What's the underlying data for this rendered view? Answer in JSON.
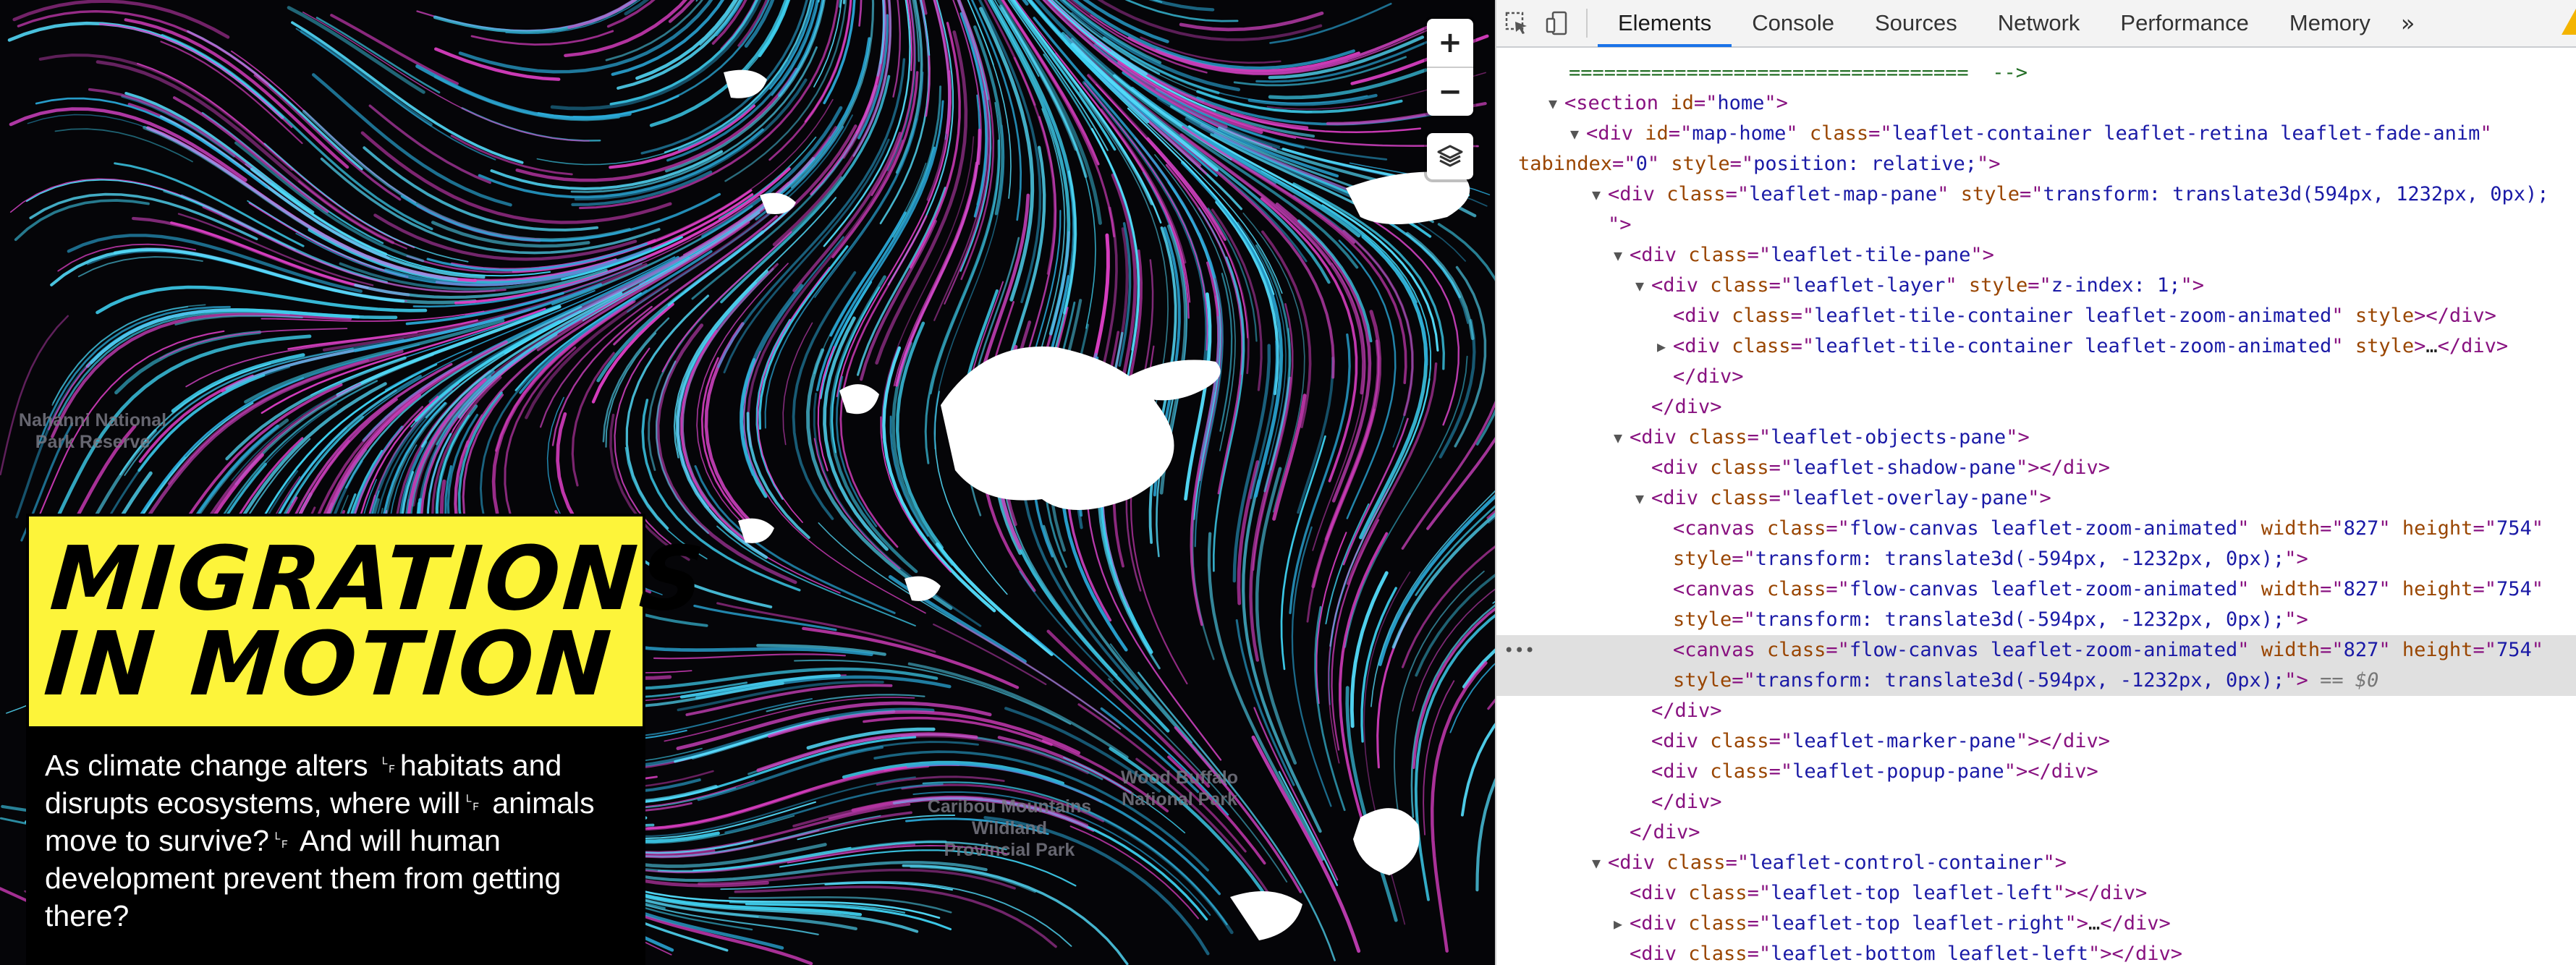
{
  "map": {
    "labels": [
      {
        "id": "nahanni",
        "text": "Nahanni National\nPark Reserve"
      },
      {
        "id": "caribou",
        "text": "Caribou Mountains\nWildland\nProvincial Park"
      },
      {
        "id": "wood-buffalo",
        "text": "Wood Buffalo\nNational Park"
      }
    ],
    "controls": {
      "zoom_in": "+",
      "zoom_out": "−",
      "layers_icon": "layers-icon"
    },
    "colors": {
      "cyan": "#3fd2f2",
      "magenta": "#e040c8",
      "land": "#ffffff",
      "background": "#050508"
    }
  },
  "story": {
    "title": "MIGRATIONS\nIN MOTION",
    "intro": "As climate change alters ␊habitats and disrupts ecosystems, where will␊ animals move to survive?␊ And will human development prevent them from getting there?",
    "title_bg": "#fdf43a"
  },
  "devtools": {
    "tabs": [
      {
        "label": "Elements",
        "active": true
      },
      {
        "label": "Console",
        "active": false
      },
      {
        "label": "Sources",
        "active": false
      },
      {
        "label": "Network",
        "active": false
      },
      {
        "label": "Performance",
        "active": false
      },
      {
        "label": "Memory",
        "active": false
      }
    ],
    "more": "»",
    "accent": "#1a73e8"
  },
  "dom_lines": [
    {
      "indent": 0,
      "tw": "",
      "parts": [
        [
          "cm",
          "==================================  -->"
        ]
      ]
    },
    {
      "indent": 1,
      "tw": "open",
      "parts": [
        [
          "tag",
          "<section "
        ],
        [
          "an",
          "id"
        ],
        [
          "tag",
          "=\""
        ],
        [
          "av",
          "home"
        ],
        [
          "tag",
          "\">"
        ]
      ]
    },
    {
      "indent": 2,
      "tw": "open",
      "parts": [
        [
          "tag",
          "<div "
        ],
        [
          "an",
          "id"
        ],
        [
          "tag",
          "=\""
        ],
        [
          "av",
          "map-home"
        ],
        [
          "tag",
          "\" "
        ],
        [
          "an",
          "class"
        ],
        [
          "tag",
          "=\""
        ],
        [
          "av",
          "leaflet-container leaflet-retina leaflet-fade-anim"
        ],
        [
          "tag",
          "\""
        ]
      ]
    },
    {
      "indent": 0,
      "tw": "",
      "parts": [
        [
          "an",
          "tabindex"
        ],
        [
          "tag",
          "=\""
        ],
        [
          "av",
          "0"
        ],
        [
          "tag",
          "\" "
        ],
        [
          "an",
          "style"
        ],
        [
          "tag",
          "=\""
        ],
        [
          "av",
          "position: relative;"
        ],
        [
          "tag",
          "\">"
        ]
      ]
    },
    {
      "indent": 3,
      "tw": "open",
      "parts": [
        [
          "tag",
          "<div "
        ],
        [
          "an",
          "class"
        ],
        [
          "tag",
          "=\""
        ],
        [
          "av",
          "leaflet-map-pane"
        ],
        [
          "tag",
          "\" "
        ],
        [
          "an",
          "style"
        ],
        [
          "tag",
          "=\""
        ],
        [
          "av",
          "transform: translate3d(594px, 1232px, 0px);"
        ]
      ]
    },
    {
      "indent": 3,
      "tw": "",
      "parts": [
        [
          "tag",
          "\">"
        ]
      ]
    },
    {
      "indent": 4,
      "tw": "open",
      "parts": [
        [
          "tag",
          "<div "
        ],
        [
          "an",
          "class"
        ],
        [
          "tag",
          "=\""
        ],
        [
          "av",
          "leaflet-tile-pane"
        ],
        [
          "tag",
          "\">"
        ]
      ]
    },
    {
      "indent": 5,
      "tw": "open",
      "parts": [
        [
          "tag",
          "<div "
        ],
        [
          "an",
          "class"
        ],
        [
          "tag",
          "=\""
        ],
        [
          "av",
          "leaflet-layer"
        ],
        [
          "tag",
          "\" "
        ],
        [
          "an",
          "style"
        ],
        [
          "tag",
          "=\""
        ],
        [
          "av",
          "z-index: 1;"
        ],
        [
          "tag",
          "\">"
        ]
      ]
    },
    {
      "indent": 6,
      "tw": "",
      "parts": [
        [
          "tag",
          "<div "
        ],
        [
          "an",
          "class"
        ],
        [
          "tag",
          "=\""
        ],
        [
          "av",
          "leaflet-tile-container leaflet-zoom-animated"
        ],
        [
          "tag",
          "\" "
        ],
        [
          "an",
          "style"
        ],
        [
          "tag",
          "></div>"
        ]
      ]
    },
    {
      "indent": 6,
      "tw": "closed",
      "parts": [
        [
          "tag",
          "<div "
        ],
        [
          "an",
          "class"
        ],
        [
          "tag",
          "=\""
        ],
        [
          "av",
          "leaflet-tile-container leaflet-zoom-animated"
        ],
        [
          "tag",
          "\" "
        ],
        [
          "an",
          "style"
        ],
        [
          "tag",
          ">"
        ],
        [
          "tx",
          "…"
        ],
        [
          "tag",
          "</div>"
        ]
      ]
    },
    {
      "indent": 6,
      "tw": "",
      "parts": [
        [
          "tag",
          "</div>"
        ]
      ]
    },
    {
      "indent": 5,
      "tw": "",
      "parts": [
        [
          "tag",
          "</div>"
        ]
      ]
    },
    {
      "indent": 4,
      "tw": "open",
      "parts": [
        [
          "tag",
          "<div "
        ],
        [
          "an",
          "class"
        ],
        [
          "tag",
          "=\""
        ],
        [
          "av",
          "leaflet-objects-pane"
        ],
        [
          "tag",
          "\">"
        ]
      ]
    },
    {
      "indent": 5,
      "tw": "",
      "parts": [
        [
          "tag",
          "<div "
        ],
        [
          "an",
          "class"
        ],
        [
          "tag",
          "=\""
        ],
        [
          "av",
          "leaflet-shadow-pane"
        ],
        [
          "tag",
          "\"></div>"
        ]
      ]
    },
    {
      "indent": 5,
      "tw": "open",
      "parts": [
        [
          "tag",
          "<div "
        ],
        [
          "an",
          "class"
        ],
        [
          "tag",
          "=\""
        ],
        [
          "av",
          "leaflet-overlay-pane"
        ],
        [
          "tag",
          "\">"
        ]
      ]
    },
    {
      "indent": 6,
      "tw": "",
      "parts": [
        [
          "tag",
          "<canvas "
        ],
        [
          "an",
          "class"
        ],
        [
          "tag",
          "=\""
        ],
        [
          "av",
          "flow-canvas leaflet-zoom-animated"
        ],
        [
          "tag",
          "\" "
        ],
        [
          "an",
          "width"
        ],
        [
          "tag",
          "=\""
        ],
        [
          "av",
          "827"
        ],
        [
          "tag",
          "\" "
        ],
        [
          "an",
          "height"
        ],
        [
          "tag",
          "=\""
        ],
        [
          "av",
          "754"
        ],
        [
          "tag",
          "\""
        ]
      ]
    },
    {
      "indent": 6,
      "tw": "",
      "parts": [
        [
          "an",
          "style"
        ],
        [
          "tag",
          "=\""
        ],
        [
          "av",
          "transform: translate3d(-594px, -1232px, 0px);"
        ],
        [
          "tag",
          "\">"
        ]
      ]
    },
    {
      "indent": 6,
      "tw": "",
      "parts": [
        [
          "tag",
          "<canvas "
        ],
        [
          "an",
          "class"
        ],
        [
          "tag",
          "=\""
        ],
        [
          "av",
          "flow-canvas leaflet-zoom-animated"
        ],
        [
          "tag",
          "\" "
        ],
        [
          "an",
          "width"
        ],
        [
          "tag",
          "=\""
        ],
        [
          "av",
          "827"
        ],
        [
          "tag",
          "\" "
        ],
        [
          "an",
          "height"
        ],
        [
          "tag",
          "=\""
        ],
        [
          "av",
          "754"
        ],
        [
          "tag",
          "\""
        ]
      ]
    },
    {
      "indent": 6,
      "tw": "",
      "parts": [
        [
          "an",
          "style"
        ],
        [
          "tag",
          "=\""
        ],
        [
          "av",
          "transform: translate3d(-594px, -1232px, 0px);"
        ],
        [
          "tag",
          "\">"
        ]
      ]
    },
    {
      "indent": 6,
      "tw": "",
      "selected": true,
      "parts": [
        [
          "tag",
          "<canvas "
        ],
        [
          "an",
          "class"
        ],
        [
          "tag",
          "=\""
        ],
        [
          "av",
          "flow-canvas leaflet-zoom-animated"
        ],
        [
          "tag",
          "\" "
        ],
        [
          "an",
          "width"
        ],
        [
          "tag",
          "=\""
        ],
        [
          "av",
          "827"
        ],
        [
          "tag",
          "\" "
        ],
        [
          "an",
          "height"
        ],
        [
          "tag",
          "=\""
        ],
        [
          "av",
          "754"
        ],
        [
          "tag",
          "\""
        ]
      ]
    },
    {
      "indent": 6,
      "tw": "",
      "selected": true,
      "parts": [
        [
          "an",
          "style"
        ],
        [
          "tag",
          "=\""
        ],
        [
          "av",
          "transform: translate3d(-594px, -1232px, 0px);"
        ],
        [
          "tag",
          "\">"
        ],
        [
          "eq0",
          " == $0"
        ]
      ]
    },
    {
      "indent": 5,
      "tw": "",
      "parts": [
        [
          "tag",
          "</div>"
        ]
      ]
    },
    {
      "indent": 5,
      "tw": "",
      "parts": [
        [
          "tag",
          "<div "
        ],
        [
          "an",
          "class"
        ],
        [
          "tag",
          "=\""
        ],
        [
          "av",
          "leaflet-marker-pane"
        ],
        [
          "tag",
          "\"></div>"
        ]
      ]
    },
    {
      "indent": 5,
      "tw": "",
      "parts": [
        [
          "tag",
          "<div "
        ],
        [
          "an",
          "class"
        ],
        [
          "tag",
          "=\""
        ],
        [
          "av",
          "leaflet-popup-pane"
        ],
        [
          "tag",
          "\"></div>"
        ]
      ]
    },
    {
      "indent": 5,
      "tw": "",
      "parts": [
        [
          "tag",
          "</div>"
        ]
      ]
    },
    {
      "indent": 4,
      "tw": "",
      "parts": [
        [
          "tag",
          "</div>"
        ]
      ]
    },
    {
      "indent": 3,
      "tw": "open",
      "parts": [
        [
          "tag",
          "<div "
        ],
        [
          "an",
          "class"
        ],
        [
          "tag",
          "=\""
        ],
        [
          "av",
          "leaflet-control-container"
        ],
        [
          "tag",
          "\">"
        ]
      ]
    },
    {
      "indent": 4,
      "tw": "",
      "parts": [
        [
          "tag",
          "<div "
        ],
        [
          "an",
          "class"
        ],
        [
          "tag",
          "=\""
        ],
        [
          "av",
          "leaflet-top leaflet-left"
        ],
        [
          "tag",
          "\"></div>"
        ]
      ]
    },
    {
      "indent": 4,
      "tw": "closed",
      "parts": [
        [
          "tag",
          "<div "
        ],
        [
          "an",
          "class"
        ],
        [
          "tag",
          "=\""
        ],
        [
          "av",
          "leaflet-top leaflet-right"
        ],
        [
          "tag",
          "\">"
        ],
        [
          "tx",
          "…"
        ],
        [
          "tag",
          "</div>"
        ]
      ]
    },
    {
      "indent": 4,
      "tw": "",
      "parts": [
        [
          "tag",
          "<div "
        ],
        [
          "an",
          "class"
        ],
        [
          "tag",
          "=\""
        ],
        [
          "av",
          "leaflet-bottom leaflet-left"
        ],
        [
          "tag",
          "\"></div>"
        ]
      ]
    }
  ]
}
